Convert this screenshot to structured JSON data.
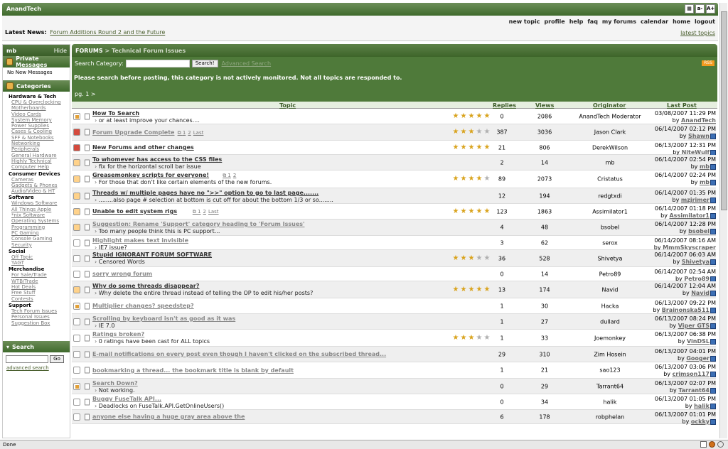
{
  "site": {
    "title": "AnandTech",
    "font_buttons": [
      "a-",
      "A+"
    ]
  },
  "nav": {
    "links": [
      "new topic",
      "profile",
      "help",
      "faq",
      "my forums",
      "calendar",
      "home",
      "logout"
    ]
  },
  "news": {
    "label": "Latest News:",
    "headline": "Forum Additions Round 2 and the Future",
    "latest_topics": "latest topics"
  },
  "sidebar": {
    "user": "mb",
    "hide": "Hide",
    "pm_title": "Private Messages",
    "no_messages": "No New Messages",
    "categories_title": "Categories",
    "groups": [
      {
        "name": "Hardware & Tech",
        "items": [
          "CPU & Overclocking",
          "Motherboards",
          "Video Cards",
          "System Memory",
          "Power Supplies",
          "Cases & Cooling",
          "SFF & Notebooks",
          "Networking",
          "Peripherals",
          "General Hardware",
          "Highly Technical",
          "Computer Help"
        ]
      },
      {
        "name": "Consumer Devices",
        "items": [
          "Cameras",
          "Gadgets & Phones",
          "Audio/Video & HT"
        ]
      },
      {
        "name": "Software",
        "items": [
          "Windows Software",
          "All Things Apple",
          "*nix Software",
          "Operating Systems",
          "Programming",
          "PC Gaming",
          "Console Gaming",
          "Security"
        ]
      },
      {
        "name": "Social",
        "items": [
          "Off Topic",
          "YAGT"
        ]
      },
      {
        "name": "Merchandise",
        "items": [
          "For Sale/Trade",
          "WTB/Trade",
          "Hot Deals",
          "Free Stuff",
          "Contests"
        ]
      },
      {
        "name": "Support",
        "items": [
          "Tech Forum Issues",
          "Personal Issues",
          "Suggestion Box"
        ]
      }
    ],
    "search_title": "Search",
    "go": "Go",
    "advanced_search": "advanced search"
  },
  "forum": {
    "crumb_forums": "FORUMS",
    "crumb_sep": ">",
    "crumb_current": "Technical Forum Issues",
    "search_label": "Search Category:",
    "search_button": "Search!",
    "advanced": "Advanced Search",
    "rss": "RSS",
    "notice": "Please search before posting, this category is not actively monitored. Not all topics are responded to.",
    "pager_label": "pg.",
    "pager_page": "1",
    "pager_next": ">",
    "columns": {
      "topic": "Topic",
      "replies": "Replies",
      "views": "Views",
      "originator": "Originator",
      "last_post": "Last Post"
    }
  },
  "topics": [
    {
      "title": "How To Search",
      "sub": "or at least improve your chances....",
      "rating": 5,
      "replies": "0",
      "views": "2086",
      "originator": "AnandTech Moderator",
      "last_date": "03/08/2007 11:29 PM",
      "last_by": "AnandTech Moderator",
      "status": "lock",
      "dim": false,
      "pages": []
    },
    {
      "title": "Forum Upgrade Complete",
      "sub": "",
      "rating": 3,
      "replies": "387",
      "views": "3036",
      "originator": "Jason Clark",
      "last_date": "06/14/2007 02:12 PM",
      "last_by": "Shawn",
      "status": "hot",
      "dim": true,
      "pages": [
        "1",
        "2",
        "Last"
      ]
    },
    {
      "title": "New Forums and other changes",
      "sub": "",
      "rating": 5,
      "replies": "21",
      "views": "806",
      "originator": "DerekWilson",
      "last_date": "06/13/2007 12:31 PM",
      "last_by": "NiteWulf",
      "status": "hot",
      "dim": false,
      "pages": []
    },
    {
      "title": "To whomever has access to the CSS files",
      "sub": "fix for the horizontal scroll bar issue",
      "rating": 0,
      "replies": "2",
      "views": "14",
      "originator": "mb",
      "last_date": "06/14/2007 02:54 PM",
      "last_by": "mb",
      "status": "newp",
      "dim": false,
      "pages": []
    },
    {
      "title": "Greasemonkey scripts for everyone!",
      "sub": "For those that don't like certain elements of the new forums.",
      "rating": 4,
      "replies": "89",
      "views": "2073",
      "originator": "Cristatus",
      "last_date": "06/14/2007 02:24 PM",
      "last_by": "mb",
      "status": "newp",
      "dim": false,
      "pages": [
        "1",
        "2"
      ]
    },
    {
      "title": "Threads w/ multiple pages have no \">>\" option to go to last page.......",
      "sub": "........also page # selection at bottom is cut off for about the bottom 1/3 or so........",
      "rating": 0,
      "replies": "12",
      "views": "194",
      "originator": "redgtxdi",
      "last_date": "06/14/2007 01:35 PM",
      "last_by": "mzjrimer",
      "status": "newp",
      "dim": false,
      "pages": []
    },
    {
      "title": "Unable to edit system rigs",
      "sub": "",
      "rating": 5,
      "replies": "123",
      "views": "1863",
      "originator": "Assimilator1",
      "last_date": "06/14/2007 01:18 PM",
      "last_by": "Assimilator1",
      "status": "newp",
      "dim": false,
      "pages": [
        "1",
        "2",
        "Last"
      ]
    },
    {
      "title": "Suggestion: Rename 'Support' category heading to 'Forum Issues'",
      "sub": "Too many people think this is PC support...",
      "rating": 0,
      "replies": "4",
      "views": "48",
      "originator": "bsobel",
      "last_date": "06/14/2007 12:28 PM",
      "last_by": "bsobel",
      "status": "newp",
      "dim": true,
      "pages": []
    },
    {
      "title": "Highlight makes text invisible",
      "sub": "IE7 issue?",
      "rating": 0,
      "replies": "3",
      "views": "62",
      "originator": "serox",
      "last_date": "06/14/2007 08:16 AM",
      "last_by": "MmmSkyscraper",
      "status": "none",
      "dim": true,
      "pages": []
    },
    {
      "title": "Stupid IGNORANT FORUM SOFTWARE",
      "sub": "Censored Words",
      "rating": 3,
      "replies": "36",
      "views": "528",
      "originator": "Shivetya",
      "last_date": "06/14/2007 06:03 AM",
      "last_by": "Shivetya",
      "status": "none",
      "dim": false,
      "pages": []
    },
    {
      "title": "sorry wrong forum",
      "sub": "",
      "rating": 0,
      "replies": "0",
      "views": "14",
      "originator": "Petro89",
      "last_date": "06/14/2007 02:54 AM",
      "last_by": "Petro89",
      "status": "none",
      "dim": true,
      "pages": []
    },
    {
      "title": "Why do some threads disappear?",
      "sub": "Why delete the entire thread instead of telling the OP to edit his/her posts?",
      "rating": 5,
      "replies": "13",
      "views": "174",
      "originator": "Navid",
      "last_date": "06/14/2007 12:04 AM",
      "last_by": "Navid",
      "status": "newp",
      "dim": false,
      "pages": []
    },
    {
      "title": "Multiplier changes? speedstep?",
      "sub": "",
      "rating": 0,
      "replies": "1",
      "views": "30",
      "originator": "Hacka",
      "last_date": "06/13/2007 09:22 PM",
      "last_by": "Brainonska511",
      "status": "lock",
      "dim": true,
      "pages": []
    },
    {
      "title": "Scrolling by keyboard isn't as good as it was",
      "sub": "IE 7.0",
      "rating": 0,
      "replies": "1",
      "views": "27",
      "originator": "dullard",
      "last_date": "06/13/2007 08:24 PM",
      "last_by": "Viper GTS",
      "status": "none",
      "dim": true,
      "pages": []
    },
    {
      "title": "Ratings broken?",
      "sub": "0 ratings have been cast for ALL topics",
      "rating": 3,
      "replies": "1",
      "views": "33",
      "originator": "Joemonkey",
      "last_date": "06/13/2007 06:38 PM",
      "last_by": "VinDSL",
      "status": "none",
      "dim": true,
      "pages": []
    },
    {
      "title": "E-mail notifications on every post even though I haven't clicked on the subscribed thread...",
      "sub": "",
      "rating": 0,
      "replies": "29",
      "views": "310",
      "originator": "Zim Hosein",
      "last_date": "06/13/2007 04:01 PM",
      "last_by": "Googer",
      "status": "none",
      "dim": true,
      "pages": []
    },
    {
      "title": "bookmarking a thread... the bookmark title is blank by default",
      "sub": "",
      "rating": 0,
      "replies": "1",
      "views": "21",
      "originator": "sao123",
      "last_date": "06/13/2007 03:06 PM",
      "last_by": "crimson117",
      "status": "none",
      "dim": true,
      "pages": []
    },
    {
      "title": "Search Down?",
      "sub": "Not working.",
      "rating": 0,
      "replies": "0",
      "views": "29",
      "originator": "Tarrant64",
      "last_date": "06/13/2007 02:07 PM",
      "last_by": "Tarrant64",
      "status": "lock",
      "dim": true,
      "pages": []
    },
    {
      "title": "Buggy FuseTalk API...",
      "sub": "Deadlocks on FuseTalk.API.GetOnlineUsers()",
      "rating": 0,
      "replies": "0",
      "views": "34",
      "originator": "halik",
      "last_date": "06/13/2007 01:05 PM",
      "last_by": "halik",
      "status": "none",
      "dim": true,
      "pages": []
    },
    {
      "title": "anyone else having a huge gray area above the",
      "sub": "",
      "rating": 0,
      "replies": "6",
      "views": "178",
      "originator": "robphelan",
      "last_date": "06/13/2007 01:01 PM",
      "last_by": "ockky",
      "status": "none",
      "dim": true,
      "pages": []
    }
  ],
  "labels": {
    "by": "by"
  },
  "status_bar": {
    "text": "Done"
  },
  "colors": {
    "green_dark": "#3f6a2c",
    "green_bar": "#4f7a3a",
    "star": "#d9a31c"
  }
}
